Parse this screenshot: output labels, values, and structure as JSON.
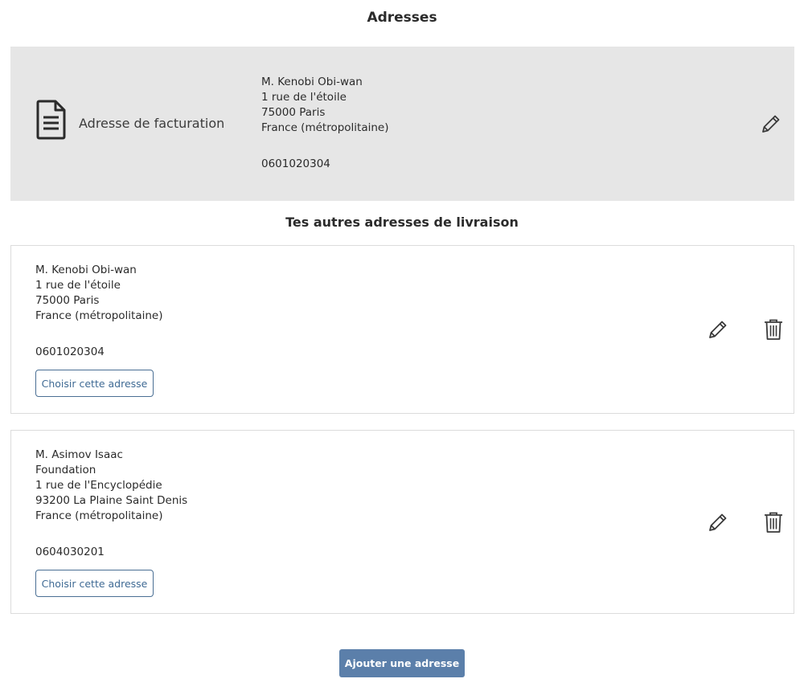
{
  "page": {
    "title": "Adresses"
  },
  "billing": {
    "label": "Adresse de facturation",
    "icon": "document-icon",
    "name": "M. Kenobi Obi-wan",
    "street": "1 rue de l'étoile",
    "city": "75000 Paris",
    "country": "France (métropolitaine)",
    "phone": "0601020304",
    "edit_icon": "pencil-icon"
  },
  "other_addresses": {
    "title": "Tes autres adresses de livraison",
    "items": [
      {
        "name": "M. Kenobi Obi-wan",
        "company": "",
        "street": "1 rue de l'étoile",
        "city": "75000 Paris",
        "country": "France (métropolitaine)",
        "phone": "0601020304",
        "choose_label": "Choisir cette adresse",
        "edit_icon": "pencil-icon",
        "delete_icon": "trash-icon"
      },
      {
        "name": "M. Asimov Isaac",
        "company": "Foundation",
        "street": "1 rue de l'Encyclopédie",
        "city": "93200 La Plaine Saint Denis",
        "country": "France (métropolitaine)",
        "phone": "0604030201",
        "choose_label": "Choisir cette adresse",
        "edit_icon": "pencil-icon",
        "delete_icon": "trash-icon"
      }
    ]
  },
  "add_button": {
    "label": "Ajouter une adresse"
  },
  "colors": {
    "primary_button": "#5b7faa",
    "outline_button": "#4a6f94",
    "billing_background": "#e6e6e6"
  }
}
